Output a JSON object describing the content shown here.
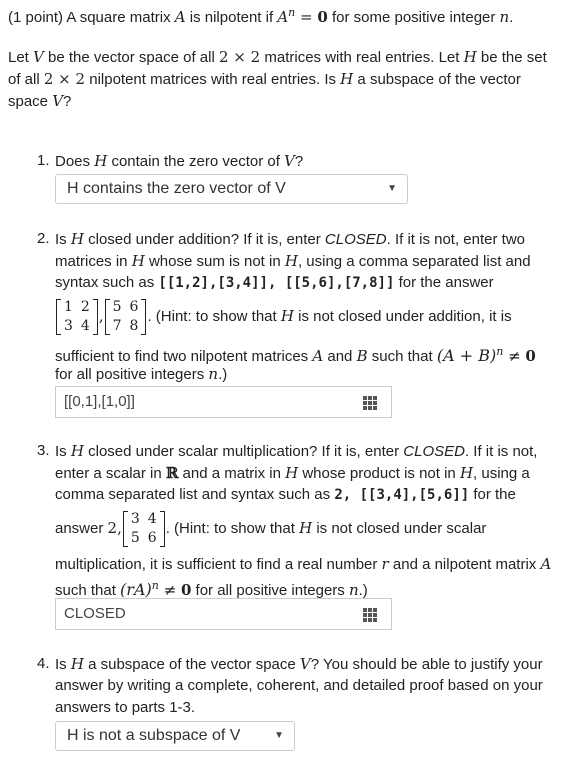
{
  "intro": {
    "points": "(1 point) A square matrix ",
    "A": "A",
    "is_nilpotent_if": " is nilpotent if ",
    "An": "A",
    "n_sup": "n",
    "eq": " = ",
    "zero": "0",
    "for_some": " for some positive integer ",
    "n": "n",
    "period": "."
  },
  "setup": {
    "line1_a": "Let ",
    "V": "V",
    "line1_b": " be the vector space of all ",
    "dims": "2 × 2",
    "line1_c": " matrices with real entries. Let ",
    "H": "H",
    "line1_d": " be the set",
    "line2_a": "of all ",
    "dims2": "2 × 2",
    "line2_b": " nilpotent matrices with real entries. Is ",
    "H2": "H",
    "line2_c": " a subspace of the vector",
    "line3_a": "space ",
    "V2": "V",
    "line3_b": "?"
  },
  "q1": {
    "num": "1.",
    "text_a": "Does ",
    "H": "H",
    "text_b": " contain the zero vector of ",
    "V": "V",
    "text_c": "?",
    "select_value": "H contains the zero vector of V"
  },
  "q2": {
    "num": "2.",
    "l1_a": "Is ",
    "H": "H",
    "l1_b": " closed under addition? If it is, enter ",
    "closed": "CLOSED",
    "l1_c": ". If it is not, enter two",
    "l2_a": "matrices in ",
    "H2": "H",
    "l2_b": " whose sum is not in ",
    "H3": "H",
    "l2_c": ", using a comma separated list and",
    "l3_a": "syntax such as ",
    "l3_code": "[[1,2],[3,4]], [[5,6],[7,8]]",
    "l3_b": " for the answer",
    "m1": [
      [
        "1",
        "2"
      ],
      [
        "3",
        "4"
      ]
    ],
    "m2": [
      [
        "5",
        "6"
      ],
      [
        "7",
        "8"
      ]
    ],
    "comma": ",",
    "l4_a": ". (Hint: to show that ",
    "H4": "H",
    "l4_b": " is not closed under addition, it is",
    "l5_a": "sufficient to find two nilpotent matrices ",
    "A": "A",
    "and": " and ",
    "B": "B",
    "l5_b": " such that ",
    "expr": "(A + B)",
    "n_sup": "n",
    "neq": " ≠ ",
    "zero": "0",
    "l6_a": "for all positive integers ",
    "n": "n",
    "l6_b": ".)",
    "input_value": "[[0,1],[1,0]]"
  },
  "q3": {
    "num": "3.",
    "l1_a": "Is ",
    "H": "H",
    "l1_b": " closed under scalar multiplication? If it is, enter ",
    "closed": "CLOSED",
    "l1_c": ". If it is not,",
    "l2_a": "enter a scalar in ",
    "R": "ℝ",
    "l2_b": " and a matrix in ",
    "H2": "H",
    "l2_c": " whose product is not in ",
    "H3": "H",
    "l2_d": ", using a",
    "l3_a": "comma separated list and syntax such as ",
    "l3_code": "2, [[3,4],[5,6]]",
    "l3_b": " for the",
    "l4_a": "answer ",
    "two": "2,",
    "m": [
      [
        "3",
        "4"
      ],
      [
        "5",
        "6"
      ]
    ],
    "l4_b": ". (Hint: to show that ",
    "H4": "H",
    "l4_c": " is not closed under scalar",
    "l5_a": "multiplication, it is sufficient to find a real number ",
    "r": "r",
    "l5_b": " and a nilpotent matrix ",
    "A": "A",
    "l6_a": "such that ",
    "expr": "(rA)",
    "n_sup": "n",
    "neq": " ≠ ",
    "zero": "0",
    "l6_b": " for all positive integers ",
    "n": "n",
    "l6_c": ".)",
    "input_value": "CLOSED"
  },
  "q4": {
    "num": "4.",
    "l1_a": "Is ",
    "H": "H",
    "l1_b": " a subspace of the vector space ",
    "V": "V",
    "l1_c": "? You should be able to justify your",
    "l2": "answer by writing a complete, coherent, and detailed proof based on your",
    "l3": "answers to parts 1-3.",
    "select_value": "H is not a subspace of V"
  }
}
